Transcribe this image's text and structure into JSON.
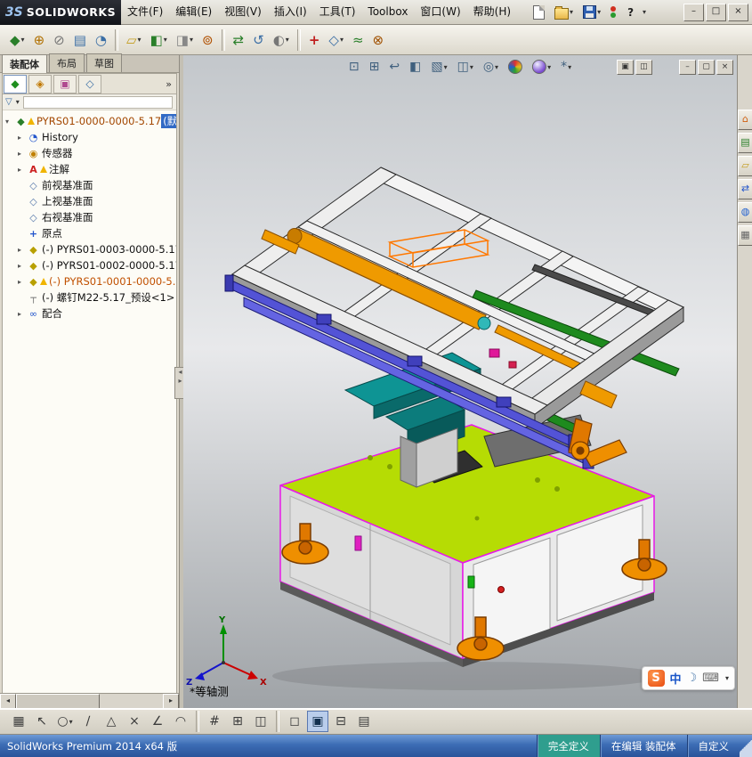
{
  "colors": {
    "accent_orange": "#ef9a00",
    "rail_purple": "#5353d6",
    "base_green": "#b6dc04",
    "edge_magenta": "#e818e8",
    "mechanism_teal": "#0e9494",
    "statusbar_blue": "#3c6cb4",
    "fully_defined_green": "#2f9e8e",
    "warning_yellow": "#f0b400"
  },
  "title_bar": {
    "logo_mark": "3S",
    "logo_text": "SOLIDWORKS",
    "menus": [
      "文件(F)",
      "编辑(E)",
      "视图(V)",
      "插入(I)",
      "工具(T)",
      "Toolbox",
      "窗口(W)",
      "帮助(H)"
    ],
    "help_label": "?",
    "window_buttons": {
      "minimize": "–",
      "maximize": "□",
      "close": "×"
    }
  },
  "standard_toolbar": {
    "icons": [
      {
        "name": "insert-components-icon",
        "glyph": "◆",
        "arrow": "▾"
      },
      {
        "name": "mate-icon",
        "glyph": "⊕",
        "arrow": ""
      },
      {
        "name": "no-preview-icon",
        "glyph": "⊘",
        "arrow": ""
      },
      {
        "name": "bill-of-materials-icon",
        "glyph": "▤",
        "arrow": ""
      },
      {
        "name": "rollback-icon",
        "glyph": "◔",
        "arrow": ""
      },
      {
        "name": "open-part-icon",
        "glyph": "▱",
        "arrow": "▾"
      },
      {
        "name": "edit-component-icon",
        "glyph": "◧",
        "arrow": "▾"
      },
      {
        "name": "large-design-review-icon",
        "glyph": "◨",
        "arrow": "▾"
      },
      {
        "name": "smart-fasteners-icon",
        "glyph": "⊚",
        "arrow": ""
      },
      {
        "name": "move-component-icon",
        "glyph": "⇄",
        "arrow": ""
      },
      {
        "name": "rotate-component-icon",
        "glyph": "↺",
        "arrow": ""
      },
      {
        "name": "hide-show-components-icon",
        "glyph": "◐",
        "arrow": "▾"
      },
      {
        "name": "assembly-features-icon",
        "glyph": "+",
        "arrow": ""
      },
      {
        "name": "reference-geometry-icon",
        "glyph": "◇",
        "arrow": "▾"
      },
      {
        "name": "motion-study-icon",
        "glyph": "≈",
        "arrow": ""
      },
      {
        "name": "interference-detection-icon",
        "glyph": "⊗",
        "arrow": ""
      }
    ]
  },
  "command_tabs": {
    "tabs": [
      {
        "label": "装配体",
        "active": true
      },
      {
        "label": "布局",
        "active": false
      },
      {
        "label": "草图",
        "active": false
      }
    ]
  },
  "feature_manager": {
    "pane_tabs": [
      {
        "name": "featuremanager-tree-tab",
        "glyph": "◆"
      },
      {
        "name": "propertymanager-tab",
        "glyph": "◈"
      },
      {
        "name": "configurationmanager-tab",
        "glyph": "▣"
      },
      {
        "name": "dimxpertmanager-tab",
        "glyph": "◇"
      }
    ],
    "overflow_label": "»",
    "filter": {
      "glyph": "▽"
    },
    "tree": {
      "items": [
        {
          "label": "PYRS01-0000-0000-5.17 ",
          "suffix": "(默",
          "icon": "assembly-icon",
          "arrow": "▾",
          "warning": true
        },
        {
          "label": "History",
          "icon": "history-icon",
          "arrow": "▸"
        },
        {
          "label": "传感器",
          "icon": "sensors-icon",
          "arrow": "▸"
        },
        {
          "label": "注解",
          "icon": "annotations-icon",
          "arrow": "▸",
          "warning": true
        },
        {
          "label": "前视基准面",
          "icon": "plane-icon",
          "arrow": ""
        },
        {
          "label": "上视基准面",
          "icon": "plane-icon",
          "arrow": ""
        },
        {
          "label": "右视基准面",
          "icon": "plane-icon",
          "arrow": ""
        },
        {
          "label": "原点",
          "icon": "origin-icon",
          "arrow": ""
        },
        {
          "label": "(-) PYRS01-0003-0000-5.17_",
          "icon": "component-icon",
          "arrow": "▸"
        },
        {
          "label": "(-) PYRS01-0002-0000-5.17_",
          "icon": "component-icon",
          "arrow": "▸"
        },
        {
          "label": "(-) PYRS01-0001-0000-5.",
          "icon": "component-icon",
          "arrow": "▸",
          "warning": true
        },
        {
          "label": "(-) 螺钉M22-5.17_预设<1>",
          "icon": "bolt-icon",
          "arrow": ""
        },
        {
          "label": "配合",
          "icon": "mates-icon",
          "arrow": "▸"
        }
      ]
    }
  },
  "viewport": {
    "view_label": "*等轴测",
    "headsup": [
      {
        "name": "zoom-fit-icon",
        "glyph": "⊡",
        "arrow": ""
      },
      {
        "name": "zoom-area-icon",
        "glyph": "⊞",
        "arrow": ""
      },
      {
        "name": "previous-view-icon",
        "glyph": "↩",
        "arrow": ""
      },
      {
        "name": "section-view-icon",
        "glyph": "◧",
        "arrow": ""
      },
      {
        "name": "view-orientation-icon",
        "glyph": "▧",
        "arrow": "▾"
      },
      {
        "name": "display-style-icon",
        "glyph": "◫",
        "arrow": "▾"
      },
      {
        "name": "hide-show-items-icon",
        "glyph": "◎",
        "arrow": "▾"
      },
      {
        "name": "edit-appearance-icon",
        "glyph": "",
        "arrow": ""
      },
      {
        "name": "apply-scene-icon",
        "glyph": "",
        "arrow": "▾"
      },
      {
        "name": "view-settings-icon",
        "glyph": "*",
        "arrow": "▾"
      }
    ],
    "doc_controls": [
      {
        "name": "new-window-icon",
        "glyph": "▣"
      },
      {
        "name": "split-window-icon",
        "glyph": "◫"
      },
      {
        "name": "doc-minimize-button",
        "glyph": "–"
      },
      {
        "name": "doc-restore-button",
        "glyph": "▢"
      },
      {
        "name": "doc-close-button",
        "glyph": "×"
      }
    ]
  },
  "task_pane": {
    "icons": [
      {
        "name": "home-icon",
        "glyph": "⌂",
        "color": "#d06010"
      },
      {
        "name": "design-library-icon",
        "glyph": "▤",
        "color": "#2a7f2a"
      },
      {
        "name": "file-explorer-icon",
        "glyph": "▱",
        "color": "#c39b1a"
      },
      {
        "name": "toolbox-icon",
        "glyph": "⇄",
        "color": "#2255cc"
      },
      {
        "name": "appearances-scenes-icon",
        "glyph": "◍",
        "color": "#2060d0"
      },
      {
        "name": "custom-properties-icon",
        "glyph": "▦",
        "color": "#666666"
      }
    ]
  },
  "sketch_toolbar": {
    "icons": [
      {
        "name": "grid-system-icon",
        "glyph": "▦"
      },
      {
        "name": "select-icon",
        "glyph": "↖"
      },
      {
        "name": "circle-tool-icon",
        "glyph": "○",
        "arrow": "▾"
      },
      {
        "name": "line-tool-icon",
        "glyph": "∕"
      },
      {
        "name": "polygon-tool-icon",
        "glyph": "△"
      },
      {
        "name": "point-tool-icon",
        "glyph": "×"
      },
      {
        "name": "angle-dimension-icon",
        "glyph": "∠"
      },
      {
        "name": "arc-tool-icon",
        "glyph": "◠"
      },
      {
        "name": "snap-icon",
        "glyph": "#"
      },
      {
        "name": "linear-pattern-icon",
        "glyph": "⊞"
      },
      {
        "name": "mirror-entities-icon",
        "glyph": "◫"
      },
      {
        "name": "wireframe-display-icon",
        "glyph": "◻"
      },
      {
        "name": "shaded-display-icon",
        "glyph": "▣",
        "pressed": true
      },
      {
        "name": "section-display-icon",
        "glyph": "⊟"
      },
      {
        "name": "grid-display-icon",
        "glyph": "▤"
      }
    ]
  },
  "status_bar": {
    "left": "SolidWorks Premium 2014 x64 版",
    "cells": [
      {
        "label": "完全定义"
      },
      {
        "label": "在编辑 装配体"
      },
      {
        "label": "自定义"
      }
    ]
  },
  "ime": {
    "logo": "S",
    "lang": "中",
    "icons": [
      {
        "name": "ime-moon-icon",
        "glyph": "☽"
      },
      {
        "name": "ime-keyboard-icon",
        "glyph": "⌨"
      }
    ]
  }
}
